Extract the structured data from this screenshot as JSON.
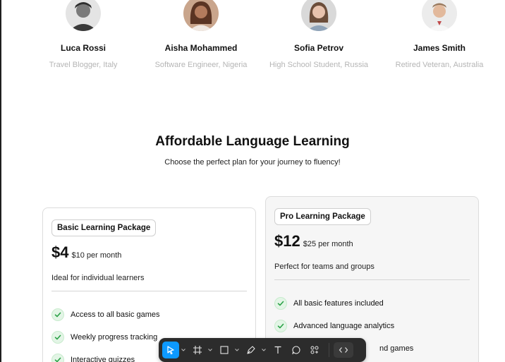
{
  "testimonials": [
    {
      "name": "Luca Rossi",
      "role": "Travel Blogger, Italy"
    },
    {
      "name": "Aisha Mohammed",
      "role": "Software Engineer, Nigeria"
    },
    {
      "name": "Sofia Petrov",
      "role": "High School Student, Russia"
    },
    {
      "name": "James Smith",
      "role": "Retired Veteran, Australia"
    }
  ],
  "pricing": {
    "title": "Affordable Language Learning",
    "subtitle": "Choose the perfect plan for your journey to fluency!",
    "plans": [
      {
        "name": "Basic Learning Package",
        "price": "$4",
        "compare": "$10 per month",
        "description": "Ideal for individual learners",
        "features": [
          "Access to all basic games",
          "Weekly progress tracking",
          "Interactive quizzes"
        ]
      },
      {
        "name": "Pro Learning Package",
        "price": "$12",
        "compare": "$25 per month",
        "description": "Perfect for teams and groups",
        "features": [
          "All basic features included",
          "Advanced language analytics",
          "nd games"
        ]
      }
    ]
  },
  "toolbar": {
    "tools": [
      "move-tool",
      "frame-tool",
      "shape-tool",
      "pen-tool",
      "text-tool",
      "comment-tool",
      "actions-tool",
      "dev-mode-toggle"
    ],
    "active_tool": "move-tool",
    "accent_color": "#0d99ff"
  },
  "colors": {
    "check_bg": "#e3f5e6",
    "check_mark": "#2aa146",
    "muted_text": "#b5b5b5"
  }
}
